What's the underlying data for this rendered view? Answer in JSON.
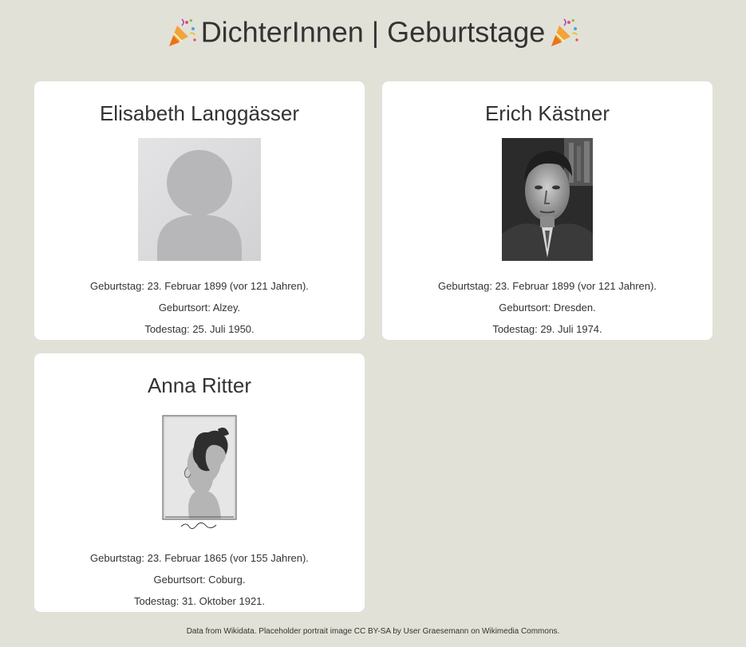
{
  "header": {
    "title": "DichterInnen | Geburtstage",
    "emoji_left": "party-popper-icon",
    "emoji_right": "party-popper-icon"
  },
  "cards": [
    {
      "name": "Elisabeth Langgässer",
      "portrait": "placeholder-portrait",
      "birthday": "Geburtstag: 23. Februar 1899 (vor 121 Jahren).",
      "birthplace": "Geburtsort: Alzey.",
      "deathday": "Todestag: 25. Juli 1950."
    },
    {
      "name": "Erich Kästner",
      "portrait": "photo-portrait",
      "birthday": "Geburtstag: 23. Februar 1899 (vor 121 Jahren).",
      "birthplace": "Geburtsort: Dresden.",
      "deathday": "Todestag: 29. Juli 1974."
    },
    {
      "name": "Anna Ritter",
      "portrait": "engraving-portrait",
      "birthday": "Geburtstag: 23. Februar 1865 (vor 155 Jahren).",
      "birthplace": "Geburtsort: Coburg.",
      "deathday": "Todestag: 31. Oktober 1921."
    }
  ],
  "footer": {
    "text": "Data from Wikidata. Placeholder portrait image CC BY-SA by User Graesemann on Wikimedia Commons."
  },
  "colors": {
    "background": "#e2e1d7",
    "card": "#ffffff",
    "text": "#333333"
  }
}
